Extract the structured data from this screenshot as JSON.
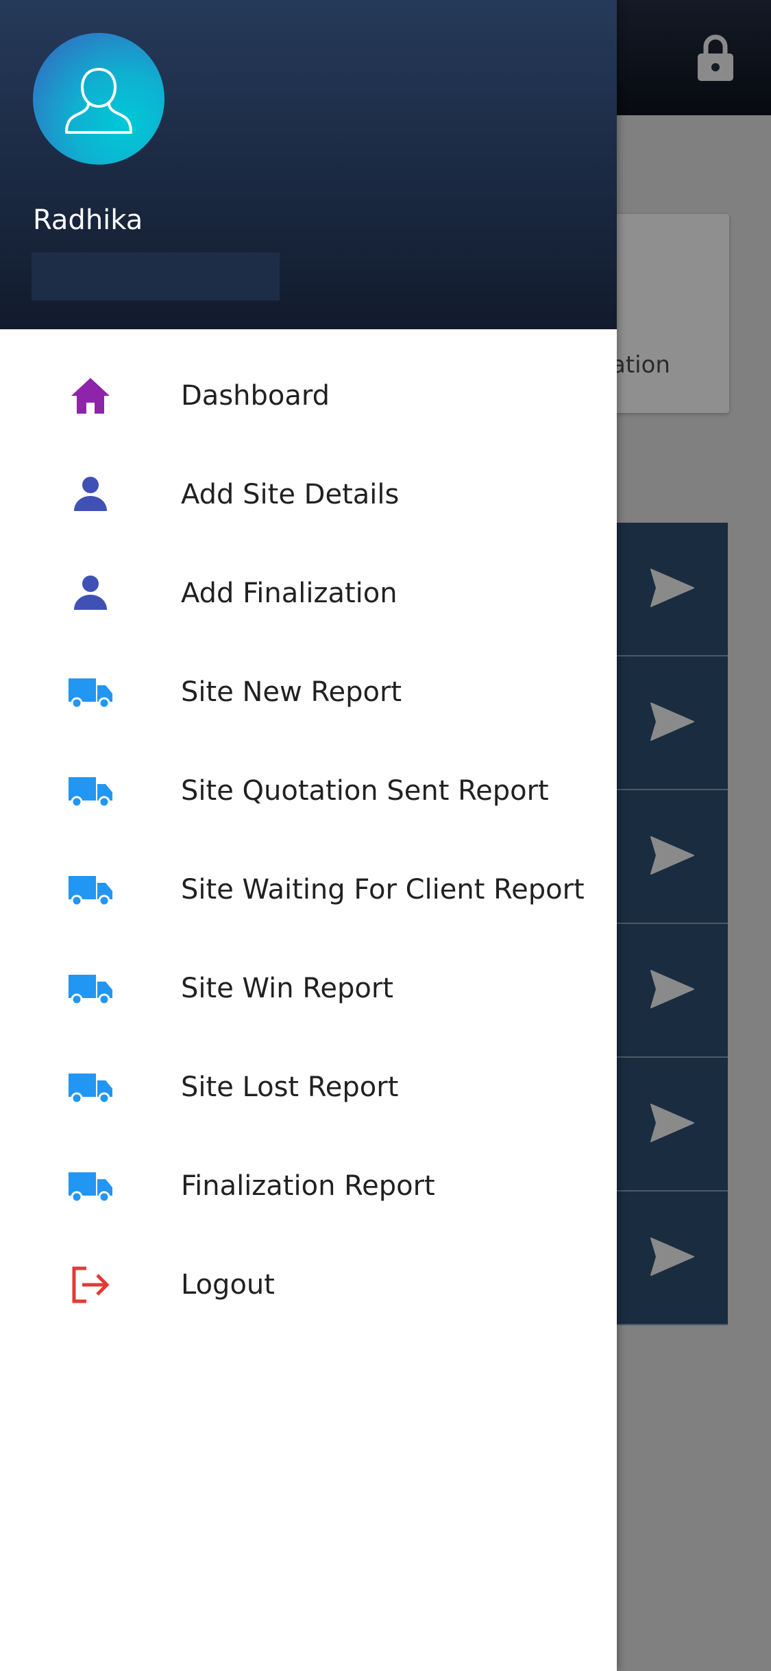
{
  "background": {
    "card_text": "ation",
    "row_count": 6
  },
  "drawer": {
    "user_name": "Radhika",
    "menu": [
      {
        "label": "Dashboard",
        "icon": "home-icon",
        "color": "#8e24aa"
      },
      {
        "label": "Add Site Details",
        "icon": "person-icon",
        "color": "#3f51b5"
      },
      {
        "label": "Add Finalization",
        "icon": "person-icon",
        "color": "#3f51b5"
      },
      {
        "label": "Site New Report",
        "icon": "truck-icon",
        "color": "#2196f3"
      },
      {
        "label": "Site Quotation Sent Report",
        "icon": "truck-icon",
        "color": "#2196f3"
      },
      {
        "label": "Site Waiting For Client Report",
        "icon": "truck-icon",
        "color": "#2196f3"
      },
      {
        "label": "Site Win Report",
        "icon": "truck-icon",
        "color": "#2196f3"
      },
      {
        "label": "Site Lost Report",
        "icon": "truck-icon",
        "color": "#2196f3"
      },
      {
        "label": "Finalization Report",
        "icon": "truck-icon",
        "color": "#2196f3"
      },
      {
        "label": "Logout",
        "icon": "logout-icon",
        "color": "#e53935"
      }
    ]
  },
  "colors": {
    "header_top": "#253a5a",
    "header_bottom": "#121b2d",
    "overlay": "#808080",
    "row_bg": "#1a2c40"
  }
}
